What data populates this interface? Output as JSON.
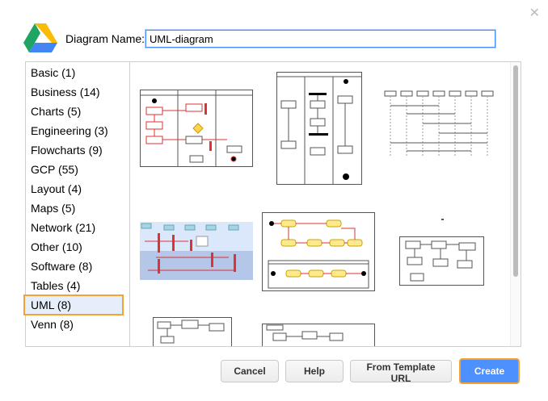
{
  "dialog": {
    "name_label": "Diagram Name:",
    "name_value": "UML-diagram",
    "close_icon": "close-icon",
    "logo_icon": "google-drive-logo"
  },
  "categories": [
    "Basic (1)",
    "Business (14)",
    "Charts (5)",
    "Engineering (3)",
    "Flowcharts (9)",
    "GCP (55)",
    "Layout (4)",
    "Maps (5)",
    "Network (21)",
    "Other (10)",
    "Software (8)",
    "Tables (4)",
    "UML (8)",
    "Venn (8)"
  ],
  "selected_category": "UML (8)",
  "buttons": {
    "cancel": "Cancel",
    "help": "Help",
    "template_url": "From Template URL",
    "create": "Create"
  },
  "colors": {
    "accent": "#4d90fe",
    "highlight": "#f4a233",
    "selected_bg": "#e7eefb"
  }
}
